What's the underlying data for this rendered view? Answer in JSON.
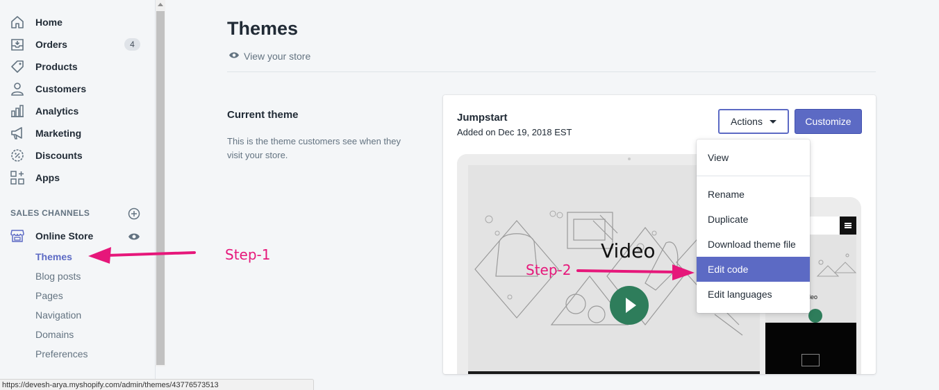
{
  "sidebar": {
    "items": [
      {
        "label": "Home",
        "icon": "home-icon"
      },
      {
        "label": "Orders",
        "icon": "orders-icon",
        "badge": "4"
      },
      {
        "label": "Products",
        "icon": "tag-icon"
      },
      {
        "label": "Customers",
        "icon": "person-icon"
      },
      {
        "label": "Analytics",
        "icon": "bar-chart-icon"
      },
      {
        "label": "Marketing",
        "icon": "megaphone-icon"
      },
      {
        "label": "Discounts",
        "icon": "discount-icon"
      },
      {
        "label": "Apps",
        "icon": "apps-icon"
      }
    ],
    "sales_channels_title": "SALES CHANNELS",
    "online_store": {
      "label": "Online Store",
      "sub_items": [
        "Themes",
        "Blog posts",
        "Pages",
        "Navigation",
        "Domains",
        "Preferences"
      ]
    }
  },
  "main": {
    "title": "Themes",
    "view_store": "View your store",
    "current_theme": {
      "title": "Current theme",
      "description": "This is the theme customers see when they visit your store."
    },
    "theme": {
      "name": "Jumpstart",
      "added": "Added on Dec 19, 2018 EST",
      "actions_label": "Actions",
      "customize_label": "Customize",
      "preview_title": "Video",
      "mobile_preview_text": "deo"
    },
    "dropdown": [
      "View",
      "Rename",
      "Duplicate",
      "Download theme file",
      "Edit code",
      "Edit languages"
    ]
  },
  "annotations": {
    "step1": "Step-1",
    "step2": "Step-2"
  },
  "statusbar": {
    "url": "https://devesh-arya.myshopify.com/admin/themes/43776573513"
  },
  "colors": {
    "accent": "#5c6ac4",
    "annotation": "#e6177a",
    "play": "#2e7d5b"
  }
}
